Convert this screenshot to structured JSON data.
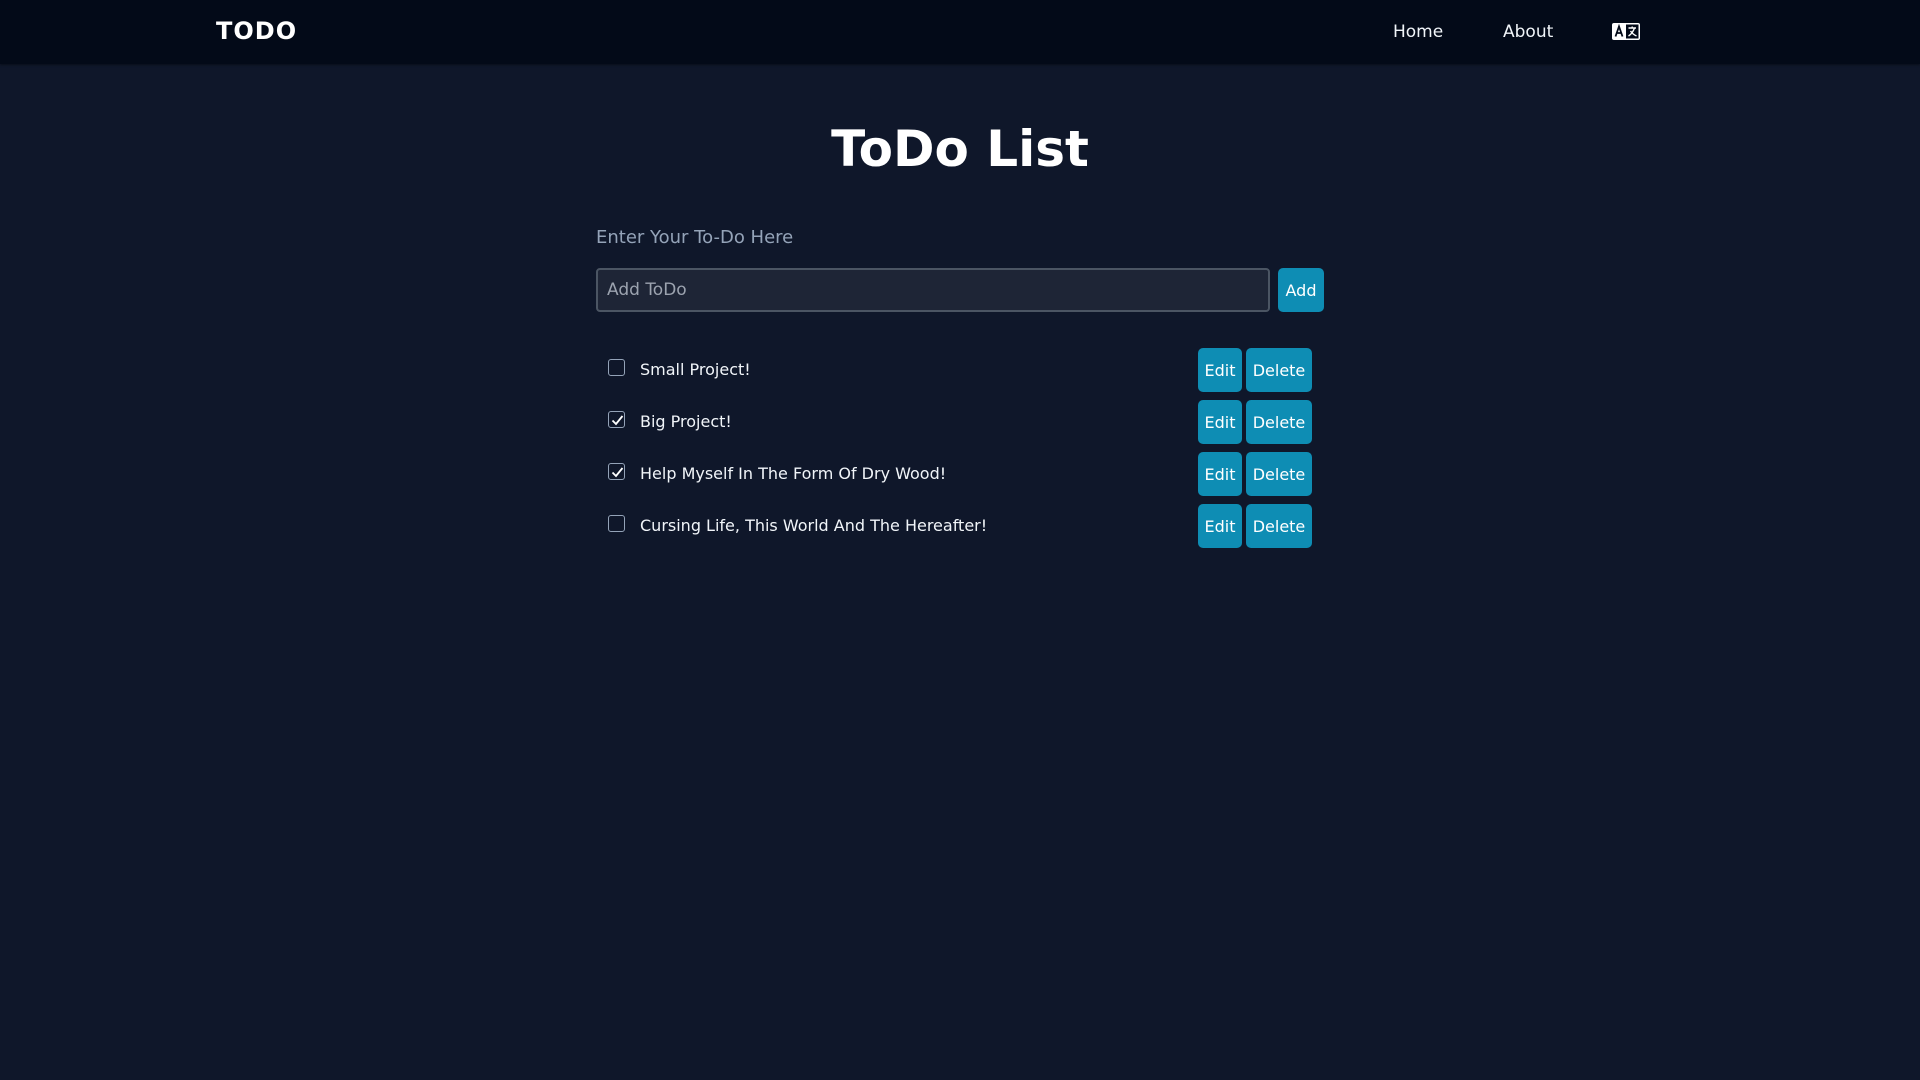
{
  "navbar": {
    "brand": "TODO",
    "links": [
      {
        "label": "Home"
      },
      {
        "label": "About"
      }
    ],
    "language_icon": "translate-icon"
  },
  "page": {
    "title": "ToDo List"
  },
  "form": {
    "label": "Enter Your To-Do Here",
    "input_value": "",
    "input_placeholder": "Add ToDo",
    "add_label": "Add"
  },
  "todos": [
    {
      "text": "Small Project!",
      "completed": false,
      "edit_label": "Edit",
      "delete_label": "Delete"
    },
    {
      "text": "Big Project!",
      "completed": true,
      "edit_label": "Edit",
      "delete_label": "Delete"
    },
    {
      "text": "Help Myself In The Form Of Dry Wood!",
      "completed": true,
      "edit_label": "Edit",
      "delete_label": "Delete"
    },
    {
      "text": "Cursing Life, This World And The Hereafter!",
      "completed": false,
      "edit_label": "Edit",
      "delete_label": "Delete"
    }
  ],
  "colors": {
    "background": "#0f172a",
    "navbar": "#030a18",
    "accent": "#0e8db4"
  }
}
